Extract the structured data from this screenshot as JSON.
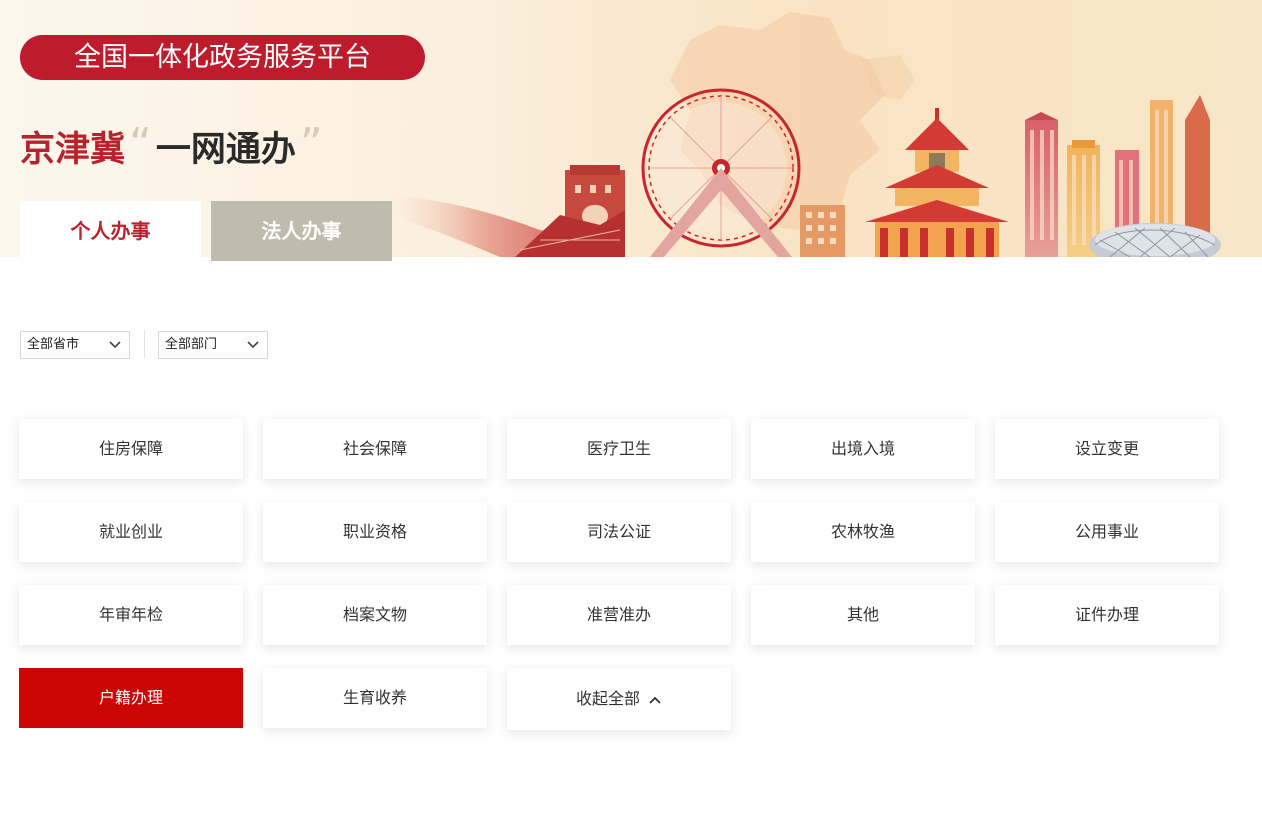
{
  "banner": {
    "platform_label": "全国一体化政务服务平台",
    "title_main": "京津冀",
    "title_open_quote": "“",
    "title_slogan": "一网通办",
    "title_close_quote": "”"
  },
  "tabs": [
    {
      "label": "个人办事",
      "active": true
    },
    {
      "label": "法人办事",
      "active": false
    }
  ],
  "filters": {
    "province": {
      "selected": "全部省市"
    },
    "department": {
      "selected": "全部部门"
    }
  },
  "categories": [
    {
      "label": "住房保障"
    },
    {
      "label": "社会保障"
    },
    {
      "label": "医疗卫生"
    },
    {
      "label": "出境入境"
    },
    {
      "label": "设立变更"
    },
    {
      "label": "就业创业"
    },
    {
      "label": "职业资格"
    },
    {
      "label": "司法公证"
    },
    {
      "label": "农林牧渔"
    },
    {
      "label": "公用事业"
    },
    {
      "label": "年审年检"
    },
    {
      "label": "档案文物"
    },
    {
      "label": "准营准办"
    },
    {
      "label": "其他"
    },
    {
      "label": "证件办理"
    },
    {
      "label": "户籍办理",
      "active": true
    },
    {
      "label": "生育收养"
    }
  ],
  "collapse": {
    "label": "收起全部",
    "icon": "chevron-up-icon"
  },
  "colors": {
    "brand_red": "#be1b2d",
    "active_red": "#cc0505",
    "tab_inactive": "#bfbcae"
  }
}
